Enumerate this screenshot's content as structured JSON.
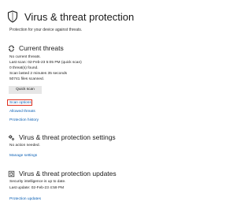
{
  "header": {
    "title": "Virus & threat protection",
    "subtitle": "Protection for your device against threats."
  },
  "current_threats": {
    "title": "Current threats",
    "lines": [
      "No current threats.",
      "Last scan: 02-Feb-23 5:05 PM (quick scan)",
      "0 threat(s) found.",
      "Scan lasted 2 minutes 35 seconds",
      "50741 files scanned."
    ],
    "quick_scan_label": "Quick scan",
    "links": [
      "Scan options",
      "Allowed threats",
      "Protection history"
    ]
  },
  "protection_settings": {
    "title": "Virus & threat protection settings",
    "status": "No action needed.",
    "link": "Manage settings"
  },
  "protection_updates": {
    "title": "Virus & threat protection updates",
    "status": "Security intelligence is up to date.",
    "last_update": "Last update: 02-Feb-23 4:59 PM",
    "link": "Protection updates"
  },
  "colors": {
    "link": "#0a5fb4",
    "highlight": "#e0301e",
    "button_bg": "#e6e6e6"
  }
}
